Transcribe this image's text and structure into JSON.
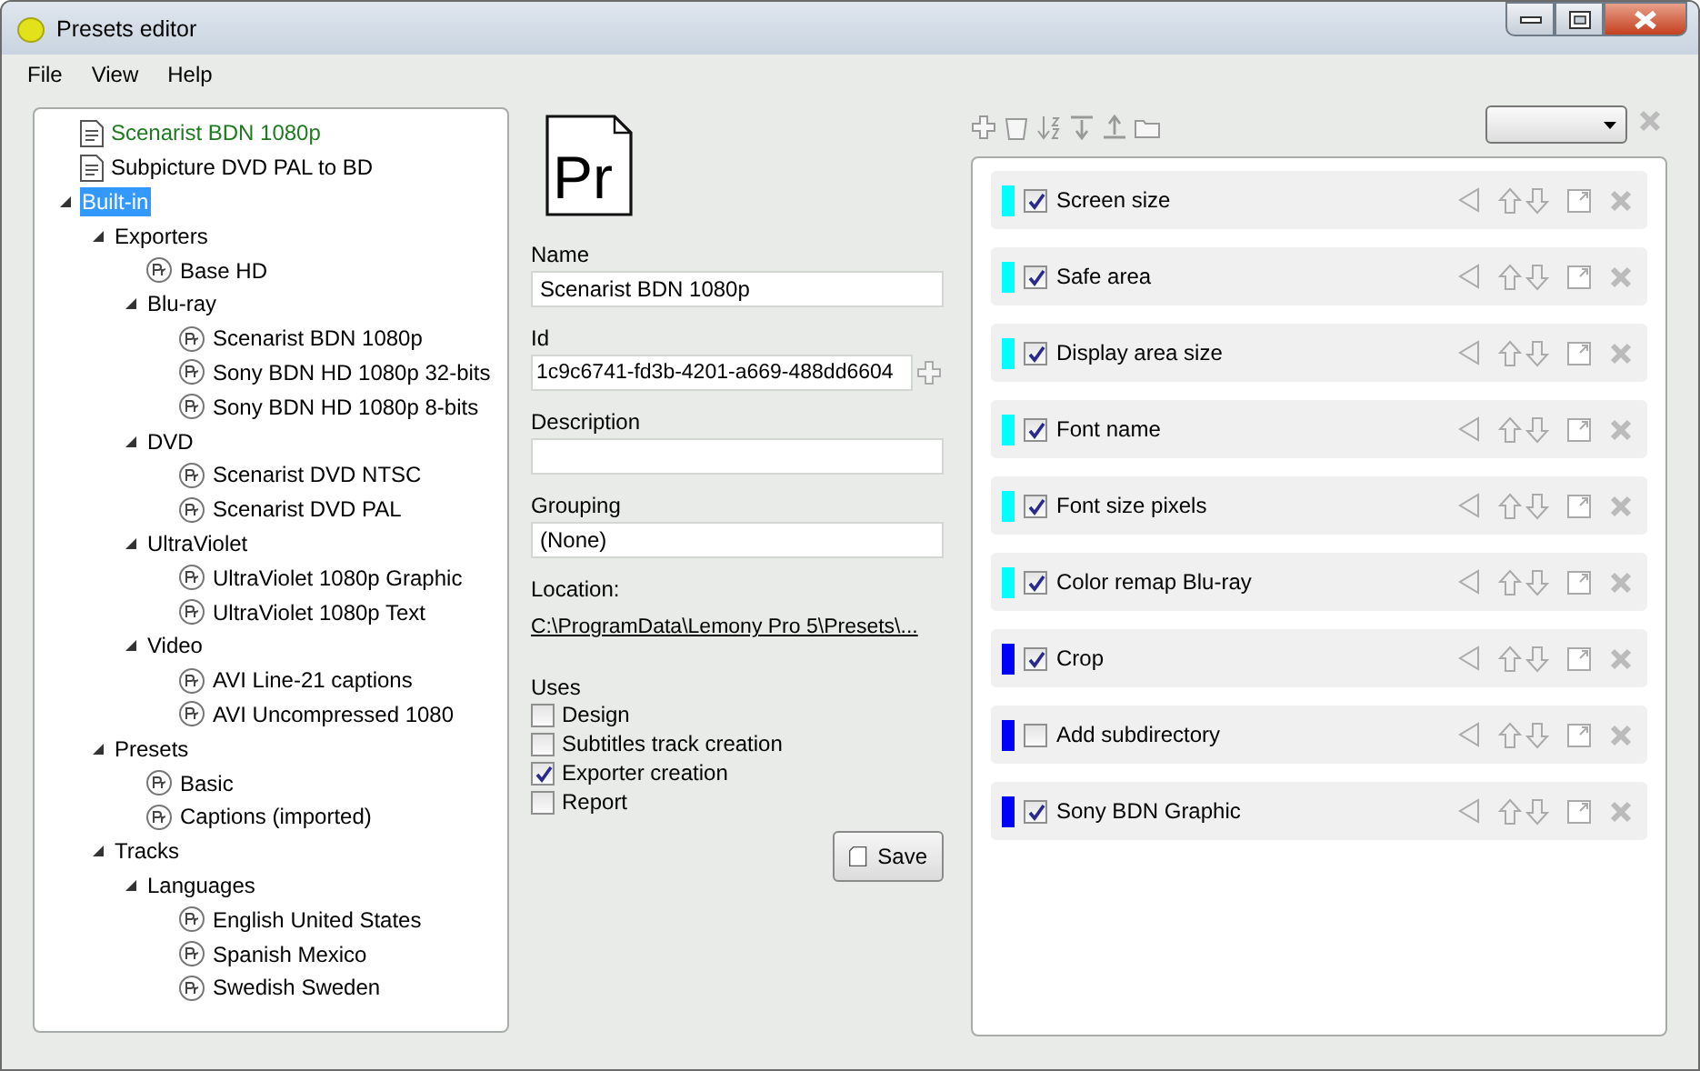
{
  "window": {
    "title": "Presets editor"
  },
  "menu": [
    "File",
    "View",
    "Help"
  ],
  "tree": [
    {
      "label": "Scenarist BDN 1080p",
      "kind": "file",
      "active": true,
      "selected": false
    },
    {
      "label": "Subpicture DVD PAL to BD",
      "kind": "file",
      "active": false,
      "selected": false
    },
    {
      "label": "Built-in",
      "kind": "folder",
      "expanded": true,
      "active": false,
      "selected": true,
      "children": [
        {
          "label": "Exporters",
          "kind": "folder",
          "expanded": true,
          "active": false,
          "selected": false,
          "children": [
            {
              "label": "Base HD",
              "kind": "preset",
              "active": false,
              "selected": false
            },
            {
              "label": "Blu-ray",
              "kind": "folder",
              "expanded": true,
              "active": false,
              "selected": false,
              "children": [
                {
                  "label": "Scenarist BDN 1080p",
                  "kind": "preset",
                  "active": false,
                  "selected": false
                },
                {
                  "label": "Sony BDN HD 1080p 32-bits",
                  "kind": "preset",
                  "active": false,
                  "selected": false
                },
                {
                  "label": "Sony BDN HD 1080p 8-bits",
                  "kind": "preset",
                  "active": false,
                  "selected": false
                }
              ]
            },
            {
              "label": "DVD",
              "kind": "folder",
              "expanded": true,
              "active": false,
              "selected": false,
              "children": [
                {
                  "label": "Scenarist DVD NTSC",
                  "kind": "preset",
                  "active": false,
                  "selected": false
                },
                {
                  "label": "Scenarist DVD PAL",
                  "kind": "preset",
                  "active": false,
                  "selected": false
                }
              ]
            },
            {
              "label": "UltraViolet",
              "kind": "folder",
              "expanded": true,
              "active": false,
              "selected": false,
              "children": [
                {
                  "label": "UltraViolet 1080p Graphic",
                  "kind": "preset",
                  "active": false,
                  "selected": false
                },
                {
                  "label": "UltraViolet 1080p Text",
                  "kind": "preset",
                  "active": false,
                  "selected": false
                }
              ]
            },
            {
              "label": "Video",
              "kind": "folder",
              "expanded": true,
              "active": false,
              "selected": false,
              "children": [
                {
                  "label": "AVI Line-21 captions",
                  "kind": "preset",
                  "active": false,
                  "selected": false
                },
                {
                  "label": "AVI Uncompressed 1080",
                  "kind": "preset",
                  "active": false,
                  "selected": false
                }
              ]
            }
          ]
        },
        {
          "label": "Presets",
          "kind": "folder",
          "expanded": true,
          "active": false,
          "selected": false,
          "children": [
            {
              "label": "Basic",
              "kind": "preset",
              "active": false,
              "selected": false
            },
            {
              "label": "Captions (imported)",
              "kind": "preset",
              "active": false,
              "selected": false
            }
          ]
        },
        {
          "label": "Tracks",
          "kind": "folder",
          "expanded": true,
          "active": false,
          "selected": false,
          "children": [
            {
              "label": "Languages",
              "kind": "folder",
              "expanded": true,
              "active": false,
              "selected": false,
              "children": [
                {
                  "label": "English United States",
                  "kind": "preset",
                  "active": false,
                  "selected": false
                },
                {
                  "label": "Spanish Mexico",
                  "kind": "preset",
                  "active": false,
                  "selected": false
                },
                {
                  "label": "Swedish Sweden",
                  "kind": "preset",
                  "active": false,
                  "selected": false
                }
              ]
            }
          ]
        }
      ]
    }
  ],
  "preset_icon": {
    "label": "Pr"
  },
  "fields": [
    {
      "label": "Name",
      "value": "Scenarist BDN 1080p",
      "kind": "text"
    },
    {
      "label": "Id",
      "value": "1c9c6741-fd3b-4201-a669-488dd6604",
      "kind": "id"
    },
    {
      "label": "Description",
      "kind": "text"
    },
    {
      "label": "Grouping",
      "value": "(None)",
      "kind": "text"
    }
  ],
  "location": {
    "label": "Location:",
    "path": "C:\\ProgramData\\Lemony Pro 5\\Presets\\..."
  },
  "uses": {
    "label": "Uses",
    "items": [
      {
        "label": "Design",
        "checked": false
      },
      {
        "label": "Subtitles track creation",
        "checked": false
      },
      {
        "label": "Exporter creation",
        "checked": true
      },
      {
        "label": "Report",
        "checked": false
      }
    ]
  },
  "save_button": "Save",
  "steps": [
    {
      "label": "Screen size",
      "checked": true,
      "color": "#00ffff"
    },
    {
      "label": "Safe area",
      "checked": true,
      "color": "#00ffff"
    },
    {
      "label": "Display area size",
      "checked": true,
      "color": "#00ffff"
    },
    {
      "label": "Font name",
      "checked": true,
      "color": "#00ffff"
    },
    {
      "label": "Font size pixels",
      "checked": true,
      "color": "#00ffff"
    },
    {
      "label": "Color remap Blu-ray",
      "checked": true,
      "color": "#00ffff"
    },
    {
      "label": "Crop",
      "checked": true,
      "color": "#0000ff"
    },
    {
      "label": "Add subdirectory",
      "checked": false,
      "color": "#0000ff"
    },
    {
      "label": "Sony BDN Graphic",
      "checked": true,
      "color": "#0000ff"
    }
  ]
}
